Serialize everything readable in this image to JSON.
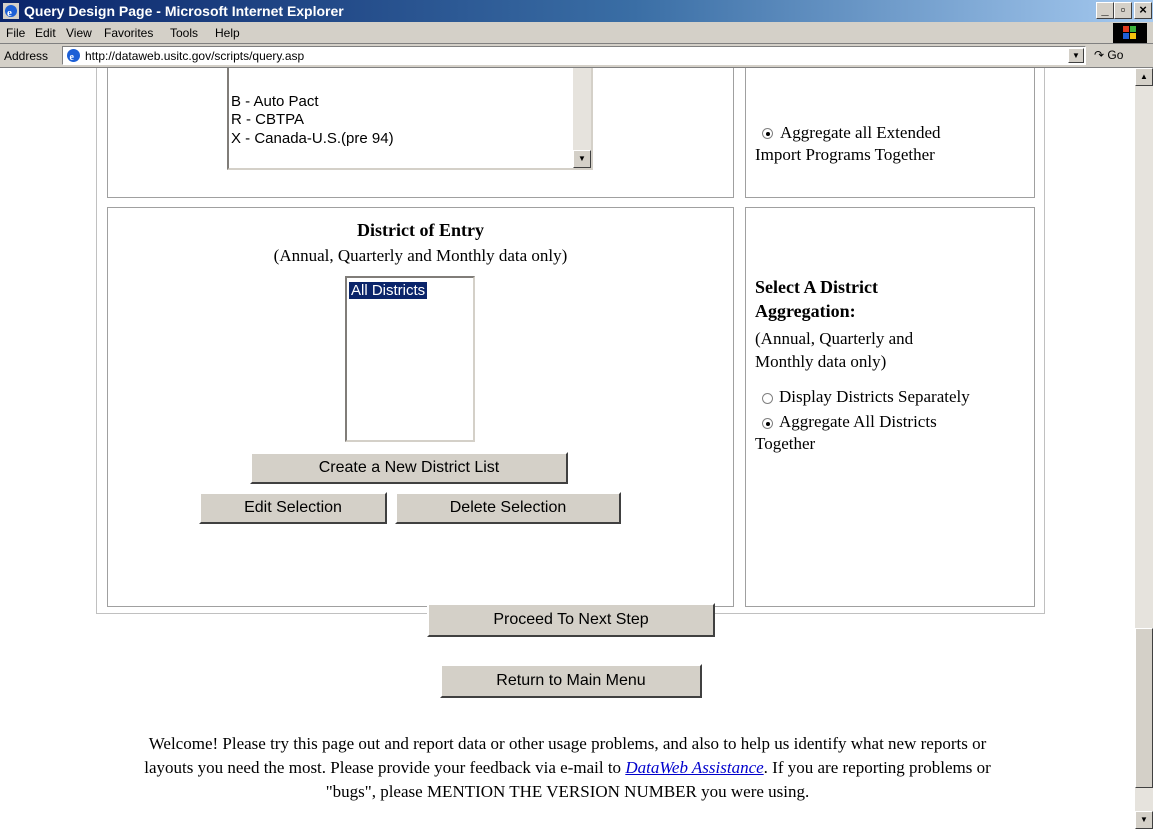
{
  "window": {
    "title": "Query Design Page - Microsoft Internet Explorer",
    "controls": {
      "minimize": "_",
      "maximize": "▫",
      "close": "×"
    }
  },
  "menu": {
    "items": [
      {
        "id": "file",
        "label": "File"
      },
      {
        "id": "edit",
        "label": "Edit"
      },
      {
        "id": "view",
        "label": "View"
      },
      {
        "id": "favorites",
        "label": "Favorites"
      },
      {
        "id": "tools",
        "label": "Tools"
      },
      {
        "id": "help",
        "label": "Help"
      }
    ]
  },
  "address_bar": {
    "label": "Address",
    "url": "http://dataweb.usitc.gov/scripts/query.asp",
    "go_label": "Go"
  },
  "import_programs": {
    "options": [
      "B - Auto Pact",
      "R - CBTPA",
      "X - Canada-U.S.(pre 94)"
    ],
    "aggregate_label": "Aggregate all Extended Import Programs Together",
    "aggregate_checked": true
  },
  "district": {
    "heading": "District of Entry",
    "subheading": "(Annual, Quarterly and Monthly data only)",
    "list_selected": "All Districts",
    "create_button": "Create a New District List",
    "edit_button": "Edit Selection",
    "delete_button": "Delete Selection",
    "aggregation_title_line1": "Select A District",
    "aggregation_title_line2": "Aggregation:",
    "aggregation_note_line1": "(Annual, Quarterly and",
    "aggregation_note_line2": "Monthly data only)",
    "option_separately": "Display Districts Separately",
    "option_together_line1": "Aggregate All Districts",
    "option_together_line2": "Together",
    "selected_option": "together"
  },
  "actions": {
    "proceed": "Proceed To Next Step",
    "return": "Return to Main Menu"
  },
  "footer": {
    "line1": "Welcome! Please try this page out and report data or other usage problems, and also to help us identify what new reports or",
    "line2_before": "layouts you need the most. Please provide your feedback via e-mail to ",
    "line2_link": "DataWeb Assistance",
    "line2_after": ". If you are reporting problems or",
    "line3": "\"bugs\", please MENTION THE VERSION NUMBER you were using."
  }
}
